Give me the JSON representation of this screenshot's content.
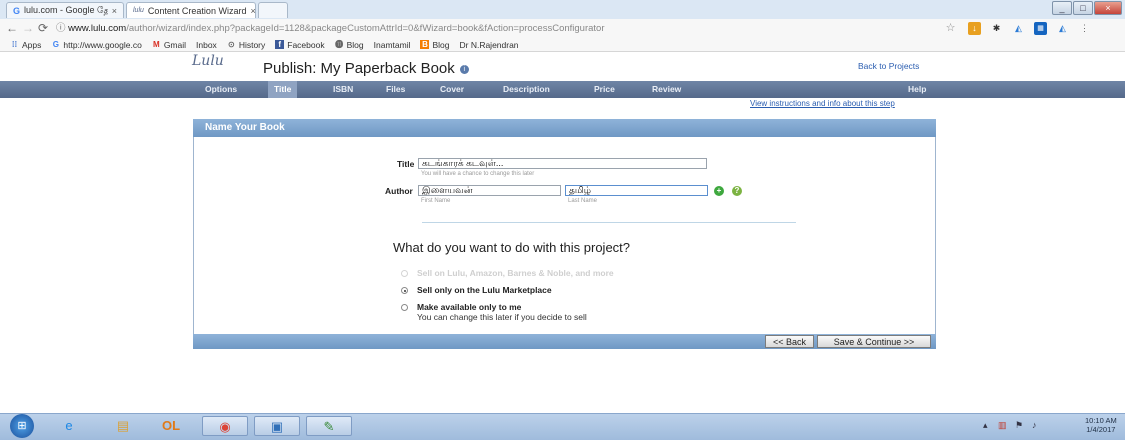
{
  "browser": {
    "tabs": [
      {
        "label": "lulu.com - Google தேட...",
        "icon": "google-icon",
        "active": false
      },
      {
        "label": "Content Creation Wizard",
        "icon": "lulu-icon",
        "active": true
      }
    ],
    "url_host": "www.lulu.com",
    "url_path": "/author/wizard/index.php?packageId=1128&packageCustomAttrId=0&fWizard=book&fAction=processConfigurator",
    "bookmarks": [
      {
        "label": "Apps",
        "icon": "apps-grid-icon"
      },
      {
        "label": "http://www.google.co",
        "icon": "google-icon"
      },
      {
        "label": "Gmail",
        "icon": "gmail-icon"
      },
      {
        "label": "Inbox",
        "icon": ""
      },
      {
        "label": "History",
        "icon": "history-icon"
      },
      {
        "label": "Facebook",
        "icon": "facebook-icon"
      },
      {
        "label": "Blog",
        "icon": "blog-icon"
      },
      {
        "label": "Inamtamil",
        "icon": ""
      },
      {
        "label": "Blog",
        "icon": "blogger-icon"
      },
      {
        "label": "Dr N.Rajendran",
        "icon": ""
      }
    ]
  },
  "header": {
    "logo": "Lulu",
    "title": "Publish: My Paperback Book",
    "back_to_projects": "Back to Projects"
  },
  "nav": {
    "tabs": [
      "Options",
      "Title",
      "ISBN",
      "Files",
      "Cover",
      "Description",
      "Price",
      "Review"
    ],
    "active": "Title",
    "help": "Help",
    "instructions_link": "View instructions and info about this step"
  },
  "panel": {
    "heading": "Name Your Book",
    "title_label": "Title",
    "title_value": "கடங்காரக் கடவுள்...",
    "title_hint": "You will have a chance to change this later",
    "author_label": "Author",
    "first_name": "இளையவன்",
    "first_hint": "First Name",
    "last_name": "தமிழ்",
    "last_hint": "Last Name",
    "question": "What do you want to do with this project?",
    "options": [
      {
        "label": "Sell on Lulu, Amazon, Barnes & Noble, and more",
        "selected": false,
        "disabled": true
      },
      {
        "label": "Sell only on the Lulu Marketplace",
        "selected": true,
        "disabled": false
      },
      {
        "label": "Make available only to me",
        "selected": false,
        "disabled": false
      }
    ],
    "option3_sub": "You can change this later if you decide to sell",
    "back_button": "<< Back",
    "save_button": "Save & Continue >>"
  },
  "taskbar": {
    "time": "10:10 AM",
    "date": "1/4/2017"
  }
}
